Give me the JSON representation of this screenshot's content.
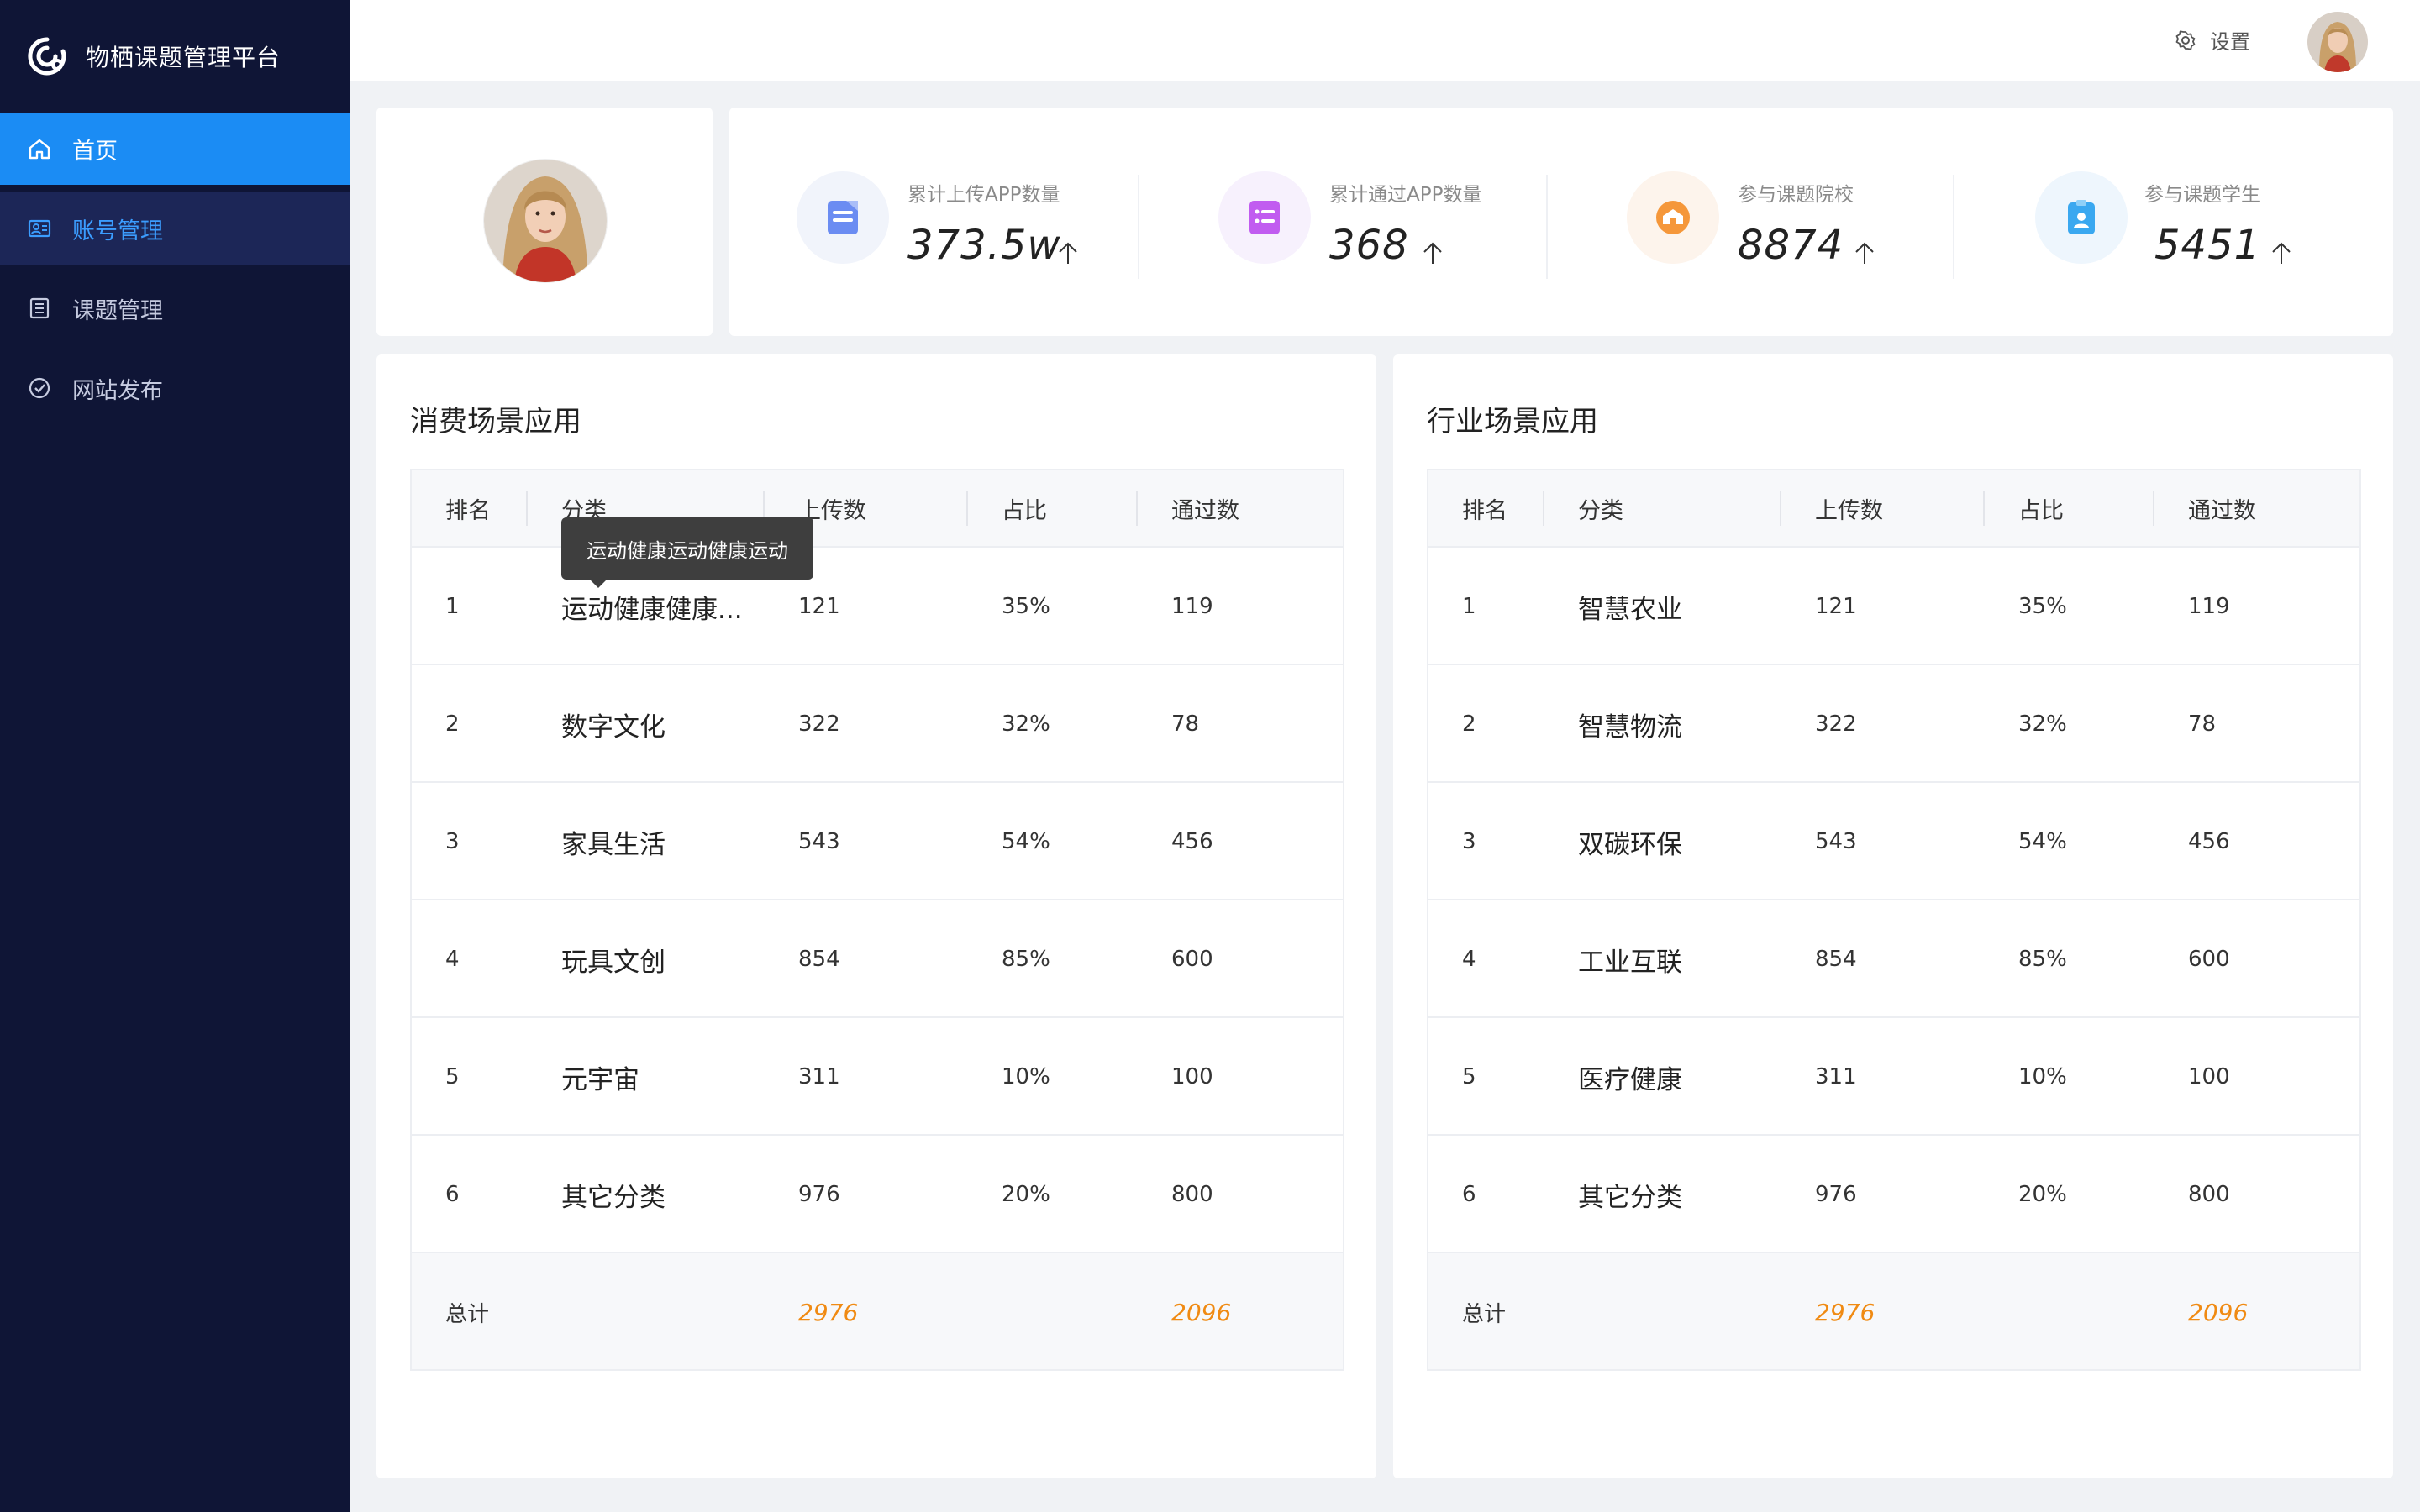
{
  "app": {
    "title": "物栖课题管理平台"
  },
  "sidebar": {
    "items": [
      {
        "label": "首页",
        "icon": "home-icon"
      },
      {
        "label": "账号管理",
        "icon": "id-card-icon"
      },
      {
        "label": "课题管理",
        "icon": "list-icon"
      },
      {
        "label": "网站发布",
        "icon": "check-circle-icon"
      }
    ]
  },
  "header": {
    "settings_label": "设置"
  },
  "stats": [
    {
      "label": "累计上传APP数量",
      "value": "373.5w",
      "icon": "document-icon",
      "color": "#6b8cf2"
    },
    {
      "label": "累计通过APP数量",
      "value": "368",
      "icon": "list-card-icon",
      "color": "#c15cf0"
    },
    {
      "label": "参与课题院校",
      "value": "8874",
      "icon": "school-icon",
      "color": "#f5973a"
    },
    {
      "label": "参与课题学生",
      "value": "5451",
      "icon": "student-badge-icon",
      "color": "#3aa8f0"
    }
  ],
  "consumer": {
    "title": "消费场景应用",
    "headers": [
      "排名",
      "分类",
      "上传数",
      "占比",
      "通过数"
    ],
    "rows": [
      {
        "rank": "1",
        "category": "运动健康健康...",
        "uploads": "121",
        "ratio": "35%",
        "passed": "119"
      },
      {
        "rank": "2",
        "category": "数字文化",
        "uploads": "322",
        "ratio": "32%",
        "passed": "78"
      },
      {
        "rank": "3",
        "category": "家具生活",
        "uploads": "543",
        "ratio": "54%",
        "passed": "456"
      },
      {
        "rank": "4",
        "category": "玩具文创",
        "uploads": "854",
        "ratio": "85%",
        "passed": "600"
      },
      {
        "rank": "5",
        "category": "元宇宙",
        "uploads": "311",
        "ratio": "10%",
        "passed": "100"
      },
      {
        "rank": "6",
        "category": "其它分类",
        "uploads": "976",
        "ratio": "20%",
        "passed": "800"
      }
    ],
    "total_label": "总计",
    "total_uploads": "2976",
    "total_passed": "2096",
    "tooltip": "运动健康运动健康运动"
  },
  "industry": {
    "title": "行业场景应用",
    "headers": [
      "排名",
      "分类",
      "上传数",
      "占比",
      "通过数"
    ],
    "rows": [
      {
        "rank": "1",
        "category": "智慧农业",
        "uploads": "121",
        "ratio": "35%",
        "passed": "119"
      },
      {
        "rank": "2",
        "category": "智慧物流",
        "uploads": "322",
        "ratio": "32%",
        "passed": "78"
      },
      {
        "rank": "3",
        "category": "双碳环保",
        "uploads": "543",
        "ratio": "54%",
        "passed": "456"
      },
      {
        "rank": "4",
        "category": "工业互联",
        "uploads": "854",
        "ratio": "85%",
        "passed": "600"
      },
      {
        "rank": "5",
        "category": "医疗健康",
        "uploads": "311",
        "ratio": "10%",
        "passed": "100"
      },
      {
        "rank": "6",
        "category": "其它分类",
        "uploads": "976",
        "ratio": "20%",
        "passed": "800"
      }
    ],
    "total_label": "总计",
    "total_uploads": "2976",
    "total_passed": "2096"
  }
}
